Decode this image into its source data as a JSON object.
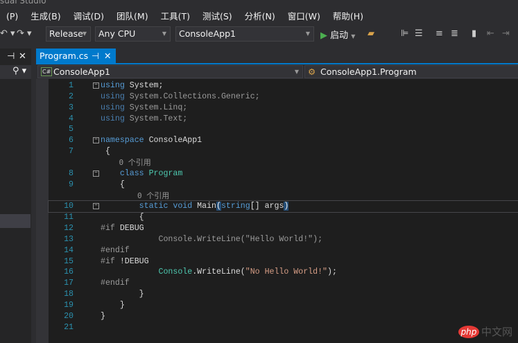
{
  "window": {
    "title": "sual Studio"
  },
  "menu": [
    "(P)",
    "生成(B)",
    "调试(D)",
    "团队(M)",
    "工具(T)",
    "测试(S)",
    "分析(N)",
    "窗口(W)",
    "帮助(H)"
  ],
  "toolbar": {
    "config": "Release",
    "platform": "Any CPU",
    "project": "ConsoleApp1",
    "start": "启动"
  },
  "tab": {
    "label": "Program.cs",
    "pin": "⊣",
    "close": "✕"
  },
  "left_panel": {
    "pin": "⊣",
    "close": "✕"
  },
  "nav": {
    "project": "ConsoleApp1",
    "class": "ConsoleApp1.Program"
  },
  "code": [
    {
      "n": "1",
      "fold": true,
      "segs": [
        [
          "kw",
          "using"
        ],
        [
          "tx",
          " System;"
        ]
      ]
    },
    {
      "n": "2",
      "segs": [
        [
          "dimkw",
          "using"
        ],
        [
          "dim",
          " System.Collections.Generic;"
        ]
      ]
    },
    {
      "n": "3",
      "segs": [
        [
          "dimkw",
          "using"
        ],
        [
          "dim",
          " System.Linq;"
        ]
      ]
    },
    {
      "n": "4",
      "segs": [
        [
          "dimkw",
          "using"
        ],
        [
          "dim",
          " System.Text;"
        ]
      ]
    },
    {
      "n": "5",
      "segs": []
    },
    {
      "n": "6",
      "fold": true,
      "segs": [
        [
          "kw",
          "namespace"
        ],
        [
          "tx",
          " ConsoleApp1"
        ]
      ]
    },
    {
      "n": "7",
      "segs": [
        [
          "tx",
          " {"
        ]
      ]
    },
    {
      "n": "",
      "lens": "    0 个引用"
    },
    {
      "n": "8",
      "fold": true,
      "segs": [
        [
          "kw",
          "    class"
        ],
        [
          "tx",
          " "
        ],
        [
          "ty",
          "Program"
        ]
      ]
    },
    {
      "n": "9",
      "segs": [
        [
          "tx",
          "    {"
        ]
      ]
    },
    {
      "n": "",
      "lens": "        0 个引用"
    },
    {
      "n": "10",
      "fold": true,
      "hl": true,
      "segs": [
        [
          "kw",
          "        static void"
        ],
        [
          "tx",
          " Main"
        ],
        [
          "brace",
          "("
        ],
        [
          "kw",
          "string"
        ],
        [
          "tx",
          "[] args"
        ],
        [
          "brace",
          ")"
        ]
      ]
    },
    {
      "n": "11",
      "segs": [
        [
          "tx",
          "        {"
        ]
      ]
    },
    {
      "n": "12",
      "segs": [
        [
          "pp",
          "#if"
        ],
        [
          "tx",
          " DEBUG"
        ]
      ]
    },
    {
      "n": "13",
      "segs": [
        [
          "dim",
          "            Console.WriteLine(\"Hello World!\");"
        ]
      ]
    },
    {
      "n": "14",
      "segs": [
        [
          "pp",
          "#endif"
        ]
      ]
    },
    {
      "n": "15",
      "segs": [
        [
          "pp",
          "#if"
        ],
        [
          "tx",
          " !DEBUG"
        ]
      ]
    },
    {
      "n": "16",
      "segs": [
        [
          "ty",
          "            Console"
        ],
        [
          "tx",
          ".WriteLine("
        ],
        [
          "str",
          "\"No Hello World!\""
        ],
        [
          "tx",
          ");"
        ]
      ]
    },
    {
      "n": "17",
      "segs": [
        [
          "pp",
          "#endif"
        ]
      ]
    },
    {
      "n": "18",
      "segs": [
        [
          "tx",
          "        }"
        ]
      ]
    },
    {
      "n": "19",
      "segs": [
        [
          "tx",
          "    }"
        ]
      ]
    },
    {
      "n": "20",
      "segs": [
        [
          "tx",
          "}"
        ]
      ]
    },
    {
      "n": "21",
      "segs": []
    }
  ],
  "watermark": {
    "badge": "php",
    "text": "中文网"
  }
}
